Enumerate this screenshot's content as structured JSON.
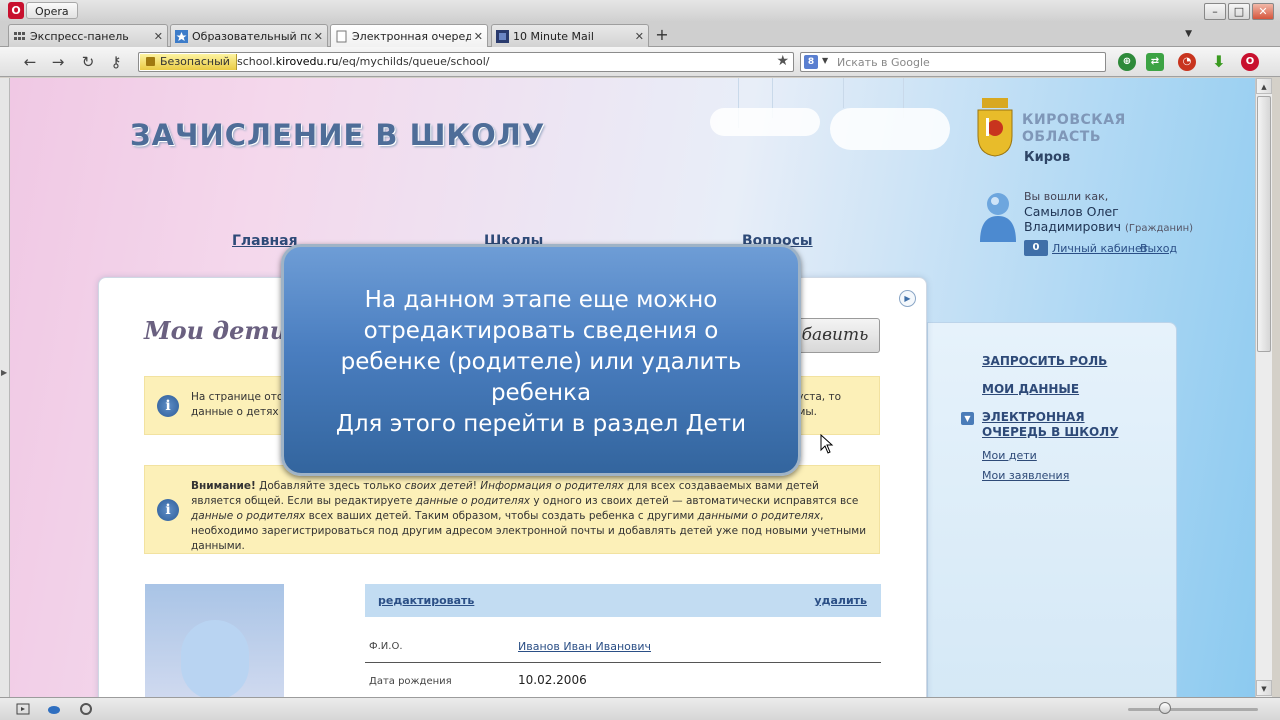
{
  "browser": {
    "menu_label": "Opera",
    "tabs": [
      {
        "title": "Экспресс-панель"
      },
      {
        "title": "Образовательный порт..."
      },
      {
        "title": "Электронная очередь : ..."
      },
      {
        "title": "10 Minute Mail"
      }
    ],
    "secure_label": "Безопасный",
    "url_prefix": "school.",
    "url_domain": "kirovedu.ru",
    "url_path": "/eq/mychilds/queue/school/",
    "search_placeholder": "Искать в Google",
    "search_engine_letter": "8",
    "opera_letter": "O"
  },
  "header": {
    "title": "ЗАЧИСЛЕНИЕ В ШКОЛУ",
    "region_line1": "КИРОВСКАЯ",
    "region_line2": "ОБЛАСТЬ",
    "city": "Киров"
  },
  "user": {
    "logged_as": "Вы вошли как,",
    "name_line1": "Самылов Олег",
    "name_line2": "Владимирович",
    "role": "(Гражданин)",
    "cabinet_count": "0",
    "cabinet_label": "Личный кабинет",
    "logout_label": "Выход"
  },
  "nav": {
    "home": "Главная",
    "schools": "Школы",
    "questions": "Вопросы"
  },
  "main": {
    "title": "Мои дети",
    "add_button": "Добавить",
    "notice1_line1": "На странице отоб",
    "notice1_line1_end": "уста, то",
    "notice1_line2": "данные о детях в",
    "notice1_line2_end": "мы.",
    "notice2": {
      "attention": "Внимание!",
      "t1": " Добавляйте здесь только ",
      "own_children": "своих детей",
      "t2": "! ",
      "parents_info": "Информация о родителях",
      "t3": " для всех создаваемых вами детей является общей. Если вы редактируете ",
      "parents_data": "данные о родителях",
      "t4": " у одного из своих детей — автоматически исправятся все ",
      "parents_data2": "данные о родителях",
      "t5": " всех ваших детей. Таким образом, чтобы создать ребенка с другими ",
      "parents_data3": "данными о родителях",
      "t6": ", необходимо зарегистрироваться под другим адресом электронной почты и добавлять детей уже под новыми учетными данными."
    },
    "child": {
      "edit": "редактировать",
      "delete": "удалить",
      "fio_label": "Ф.И.О.",
      "fio_value": "Иванов Иван Иванович",
      "birth_label": "Дата рождения",
      "birth_value": "10.02.2006"
    }
  },
  "sidemenu": {
    "request_role": "ЗАПРОСИТЬ РОЛЬ",
    "my_data": "МОИ ДАННЫЕ",
    "queue_line1": "ЭЛЕКТРОННАЯ",
    "queue_line2": "ОЧЕРЕДЬ В ШКОЛУ",
    "my_children": "Мои дети",
    "my_applications": "Мои заявления"
  },
  "overlay": {
    "line1": "На данном этапе еще можно",
    "line2": "отредактировать сведения о",
    "line3": "ребенке (родителе) или удалить",
    "line4": "ребенка",
    "line5": "Для этого перейти в раздел Дети"
  },
  "colors": {
    "accent": "#3f6fa8",
    "notice_bg": "#fcf0b8",
    "overlay_bg": "#4a7ec0"
  }
}
